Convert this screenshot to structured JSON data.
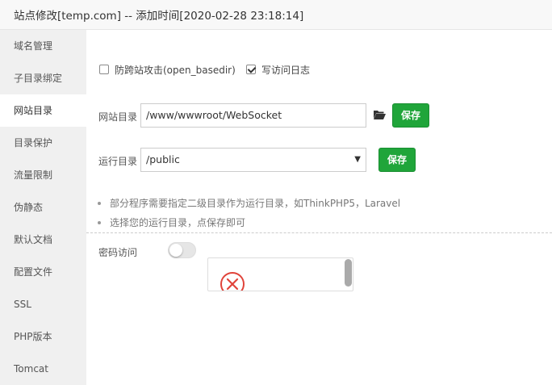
{
  "window": {
    "title": "站点修改[temp.com] -- 添加时间[2020-02-28 23:18:14]"
  },
  "sidebar": {
    "items": [
      {
        "label": "域名管理"
      },
      {
        "label": "子目录绑定"
      },
      {
        "label": "网站目录",
        "active": true
      },
      {
        "label": "目录保护"
      },
      {
        "label": "流量限制"
      },
      {
        "label": "伪静态"
      },
      {
        "label": "默认文档"
      },
      {
        "label": "配置文件"
      },
      {
        "label": "SSL"
      },
      {
        "label": "PHP版本"
      },
      {
        "label": "Tomcat"
      }
    ]
  },
  "options": {
    "anti_cross_site": {
      "label": "防跨站攻击(open_basedir)",
      "checked": false
    },
    "access_log": {
      "label": "写访问日志",
      "checked": true
    }
  },
  "site_dir": {
    "label": "网站目录",
    "value": "/www/wwwroot/WebSocket",
    "icon": "folder-open-icon",
    "save_label": "保存"
  },
  "run_dir": {
    "label": "运行目录",
    "selected": "/public",
    "save_label": "保存"
  },
  "tips": [
    "部分程序需要指定二级目录作为运行目录，如ThinkPHP5，Laravel",
    "选择您的运行目录，点保存即可"
  ],
  "password_access": {
    "label": "密码访问",
    "enabled": false
  },
  "popup": {
    "icon": "error-circle-icon"
  },
  "colors": {
    "accent_green": "#20a53a",
    "error_red": "#e0433a",
    "sidebar_bg": "#f0f0f0"
  }
}
